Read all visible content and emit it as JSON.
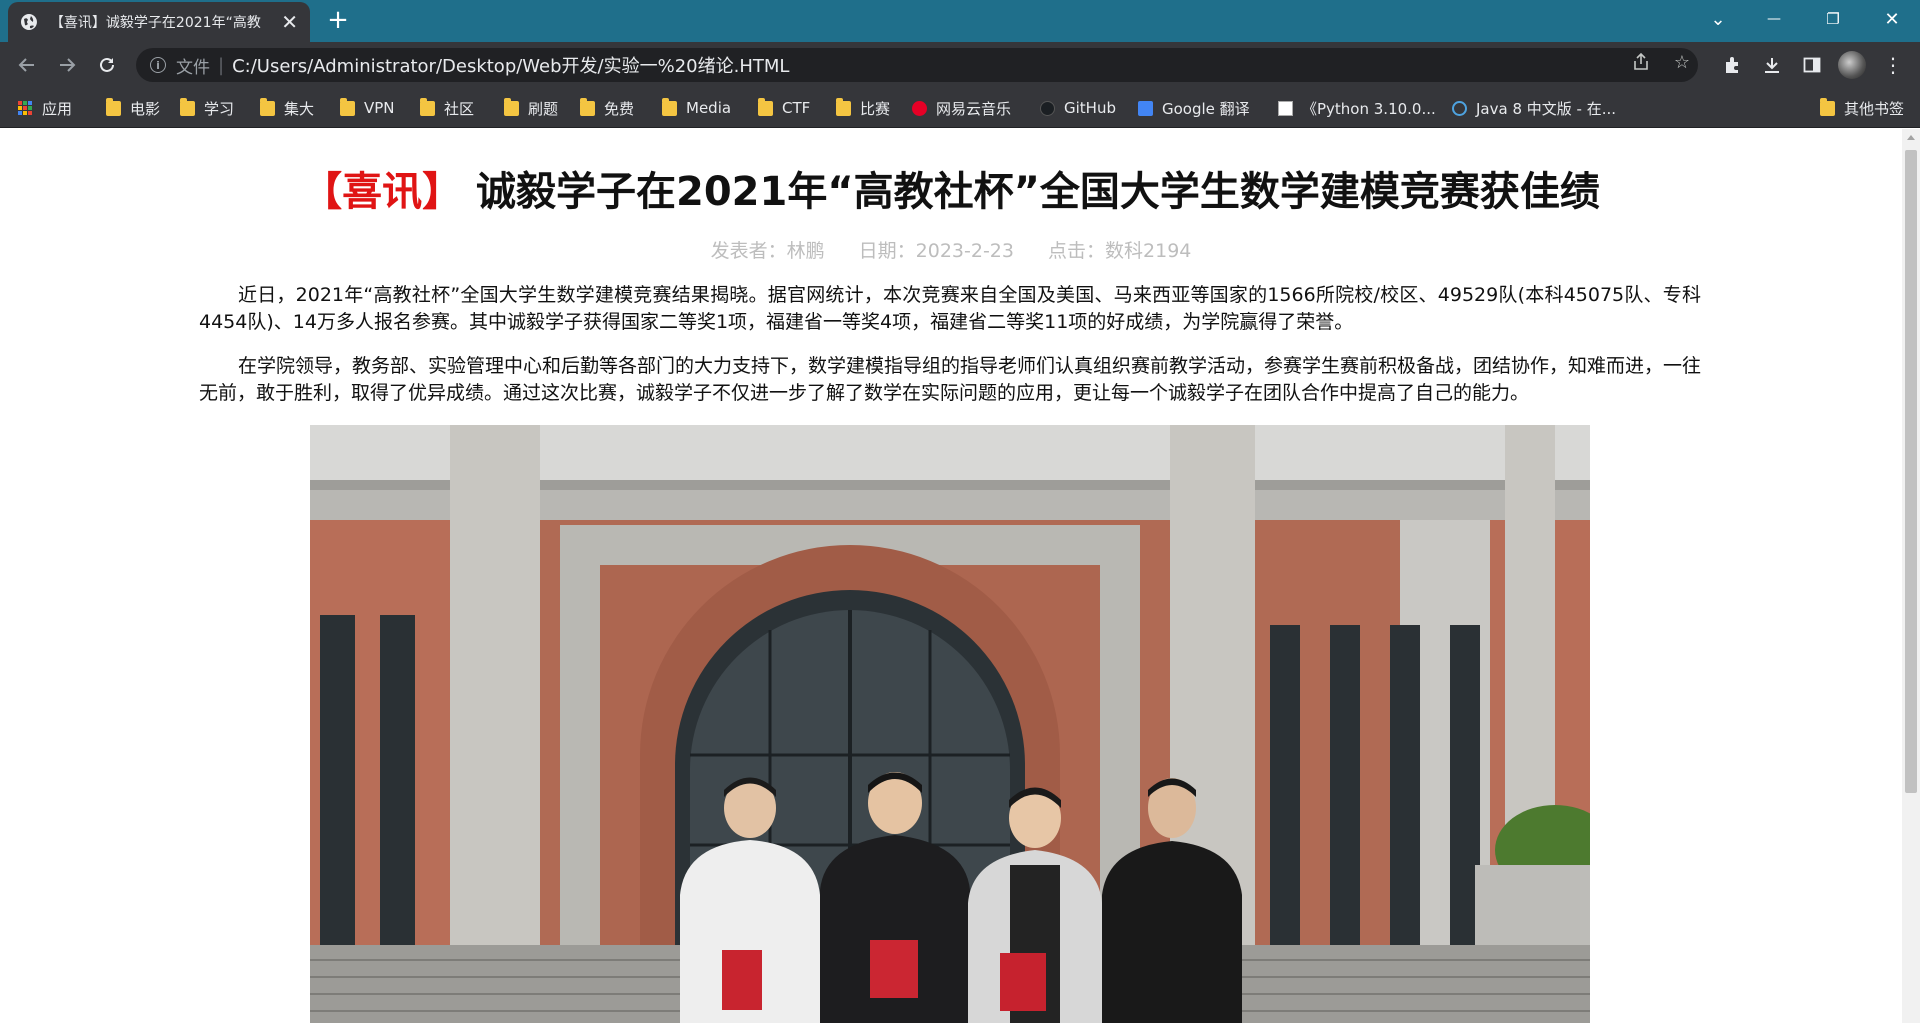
{
  "browser": {
    "tab_title": "【喜讯】诚毅学子在2021年“高教",
    "tab_close": "✕",
    "new_tab": "+",
    "window_controls": {
      "dropdown": "⌄",
      "minimize": "—",
      "restore": "❐",
      "close": "✕"
    },
    "url_prefix": "文件",
    "url": "C:/Users/Administrator/Desktop/Web开发/实验一%20绪论.HTML",
    "bookmarks": [
      {
        "label": "应用",
        "icon": "apps-grid-icon"
      },
      {
        "label": "电影",
        "icon": "folder-icon"
      },
      {
        "label": "学习",
        "icon": "folder-icon"
      },
      {
        "label": "集大",
        "icon": "folder-icon"
      },
      {
        "label": "VPN",
        "icon": "folder-icon"
      },
      {
        "label": "社区",
        "icon": "folder-icon"
      },
      {
        "label": "刷题",
        "icon": "folder-icon"
      },
      {
        "label": "免费",
        "icon": "folder-icon"
      },
      {
        "label": "Media",
        "icon": "folder-icon"
      },
      {
        "label": "CTF",
        "icon": "folder-icon"
      },
      {
        "label": "比赛",
        "icon": "folder-icon"
      },
      {
        "label": "网易云音乐",
        "icon": "netease-music-icon"
      },
      {
        "label": "GitHub",
        "icon": "github-icon"
      },
      {
        "label": "Google 翻译",
        "icon": "google-translate-icon"
      },
      {
        "label": "《Python 3.10.0...",
        "icon": "page-icon"
      },
      {
        "label": "Java 8 中文版 - 在...",
        "icon": "java-icon"
      }
    ],
    "other_bookmarks": "其他书签"
  },
  "article": {
    "tag": "【喜讯】",
    "title": "诚毅学子在2021年“高教社杯”全国大学生数学建模竞赛获佳绩",
    "author": "发表者：林鹏",
    "date": "日期：2023-2-23",
    "clicks": "点击：数科2194",
    "paragraph1": "近日，2021年“高教社杯”全国大学生数学建模竞赛结果揭晓。据官网统计，本次竞赛来自全国及美国、马来西亚等国家的1566所院校/校区、49529队(本科45075队、专科4454队)、14万多人报名参赛。其中诚毅学子获得国家二等奖1项，福建省一等奖4项，福建省二等奖11项的好成绩，为学院赢得了荣誉。",
    "paragraph2": "在学院领导，教务部、实验管理中心和后勤等各部门的大力支持下，数学建模指导组的指导老师们认真组织赛前教学活动，参赛学生赛前积极备战，团结协作，知难而进，一往无前，敢于胜利，取得了优异成绩。通过这次比赛，诚毅学子不仅进一步了解了数学在实际问题的应用，更让每一个诚毅学子在团队合作中提高了自己的能力。"
  },
  "colors": {
    "titlebar": "#1f6f8b",
    "toolbar": "#35363a",
    "tag_red": "#e01414",
    "meta_gray": "#bdbdbd"
  }
}
